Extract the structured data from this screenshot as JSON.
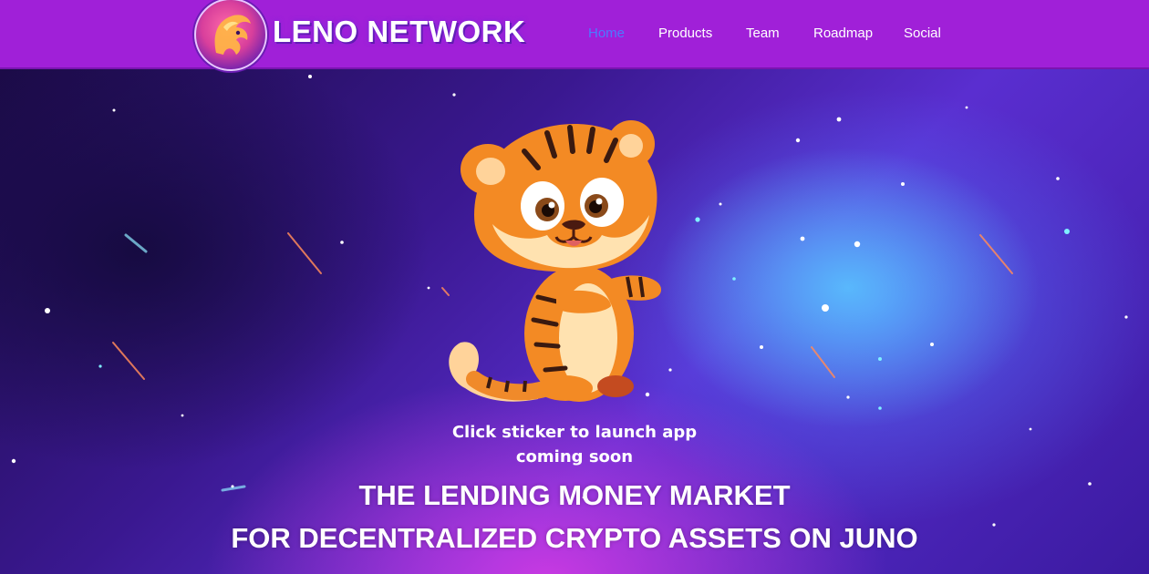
{
  "brand": {
    "name": "LENO NETWORK"
  },
  "nav": {
    "items": [
      {
        "label": "Home",
        "active": true
      },
      {
        "label": "Products",
        "active": false
      },
      {
        "label": "Team",
        "active": false
      },
      {
        "label": "Roadmap",
        "active": false
      },
      {
        "label": "Social",
        "active": false
      }
    ]
  },
  "hero": {
    "launch_text": "Click sticker to launch app",
    "status_text": "coming soon",
    "headline_line1": "THE LENDING MONEY MARKET",
    "headline_line2": "FOR DECENTRALIZED CRYPTO ASSETS ON JUNO"
  },
  "colors": {
    "header_bg": "#a020d8",
    "nav_active": "#4b7bff",
    "nav_text": "#ffffff"
  }
}
